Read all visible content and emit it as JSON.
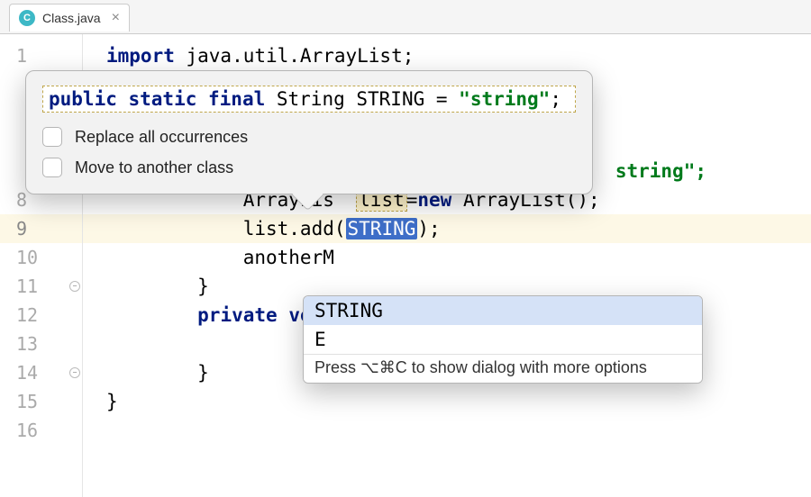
{
  "tab": {
    "icon_letter": "C",
    "label": "Class.java"
  },
  "gutter": {
    "lines": [
      "1",
      "",
      "",
      "",
      "",
      "8",
      "9",
      "10",
      "11",
      "12",
      "13",
      "14",
      "15",
      "16"
    ],
    "current_line_index": 6,
    "fold_indices": [
      8,
      11
    ]
  },
  "code": {
    "l1_kw": "import",
    "l1_rest": " java.util.ArrayList;",
    "l5_tail": "string\";",
    "l8_pre": "            ArrayLis  ",
    "l8_list": "list",
    "l8_eq": "=",
    "l8_new": "new",
    "l8_tail": " ArrayList();",
    "l9_pre": "            list.add(",
    "l9_sel": "STRING",
    "l9_post": ");",
    "l10_pre": "            anotherM",
    "l11": "        }",
    "l12_pre": "        ",
    "l12_kw1": "private",
    "l12_kw2": " void",
    "l13": "",
    "l14": "        }",
    "l15": "}"
  },
  "extract_popup": {
    "kw_public": "public",
    "kw_static": " static",
    "kw_final": " final",
    "type": " String STRING = ",
    "str": "\"string\"",
    "semi": ";",
    "opt_replace": "Replace all occurrences",
    "opt_move": "Move to another class"
  },
  "completion_popup": {
    "items": [
      "STRING",
      "E"
    ],
    "selected_index": 0,
    "hint": "Press ⌥⌘C to show dialog with more options"
  }
}
